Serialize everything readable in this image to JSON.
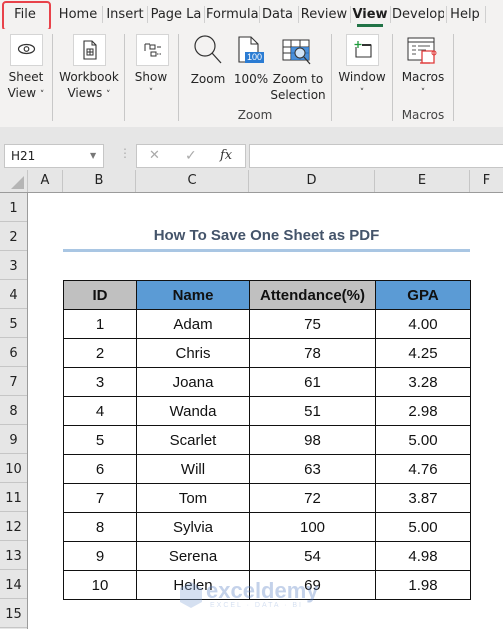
{
  "ribbon_tabs": [
    {
      "label": "File",
      "active": false,
      "highlighted": true
    },
    {
      "label": "Home",
      "active": false
    },
    {
      "label": "Insert",
      "active": false
    },
    {
      "label": "Page La",
      "active": false
    },
    {
      "label": "Formula",
      "active": false
    },
    {
      "label": "Data",
      "active": false
    },
    {
      "label": "Review",
      "active": false
    },
    {
      "label": "View",
      "active": true
    },
    {
      "label": "Develop",
      "active": false
    },
    {
      "label": "Help",
      "active": false
    }
  ],
  "ribbon": {
    "sheet_view": {
      "line1": "Sheet",
      "line2": "View",
      "icon": "eye-icon"
    },
    "workbook_views": {
      "line1": "Workbook",
      "line2": "Views",
      "icon": "workbook-views-icon"
    },
    "show": {
      "line1": "Show",
      "icon": "show-icon"
    },
    "zoom": {
      "label": "Zoom",
      "icon": "magnifier-icon"
    },
    "zoom100": {
      "label": "100%",
      "badge": "100",
      "icon": "page-100-icon"
    },
    "zoom_selection": {
      "line1": "Zoom to",
      "line2": "Selection",
      "icon": "zoom-selection-icon"
    },
    "zoom_group_label": "Zoom",
    "window": {
      "label": "Window",
      "icon": "new-window-icon"
    },
    "macros": {
      "label": "Macros",
      "icon": "macros-icon"
    },
    "macros_group_label": "Macros",
    "chevron": "˅"
  },
  "formula_bar": {
    "name_box": "H21",
    "cancel_symbol": "✕",
    "enter_symbol": "✓",
    "fx_symbol": "fx",
    "formula": ""
  },
  "columns": [
    "A",
    "B",
    "C",
    "D",
    "E",
    "F"
  ],
  "rows": [
    "1",
    "2",
    "3",
    "4",
    "5",
    "6",
    "7",
    "8",
    "9",
    "10",
    "11",
    "12",
    "13",
    "14",
    "15"
  ],
  "sheet": {
    "title": "How To Save One Sheet as PDF",
    "headers": [
      "ID",
      "Name",
      "Attendance(%)",
      "GPA"
    ],
    "data": [
      [
        "1",
        "Adam",
        "75",
        "4.00"
      ],
      [
        "2",
        "Chris",
        "78",
        "4.25"
      ],
      [
        "3",
        "Joana",
        "61",
        "3.28"
      ],
      [
        "4",
        "Wanda",
        "51",
        "2.98"
      ],
      [
        "5",
        "Scarlet",
        "98",
        "5.00"
      ],
      [
        "6",
        "Will",
        "63",
        "4.76"
      ],
      [
        "7",
        "Tom",
        "72",
        "3.87"
      ],
      [
        "8",
        "Sylvia",
        "100",
        "5.00"
      ],
      [
        "9",
        "Serena",
        "54",
        "4.98"
      ],
      [
        "10",
        "Helen",
        "69",
        "1.98"
      ]
    ]
  },
  "watermark": {
    "brand": "exceldemy",
    "tagline": "EXCEL · DATA · BI"
  },
  "colors": {
    "accent_green": "#217346",
    "highlight_red": "#e8424a",
    "header_blue": "#5b9bd5",
    "header_grey": "#c0c0c0",
    "title_color": "#44546a"
  }
}
